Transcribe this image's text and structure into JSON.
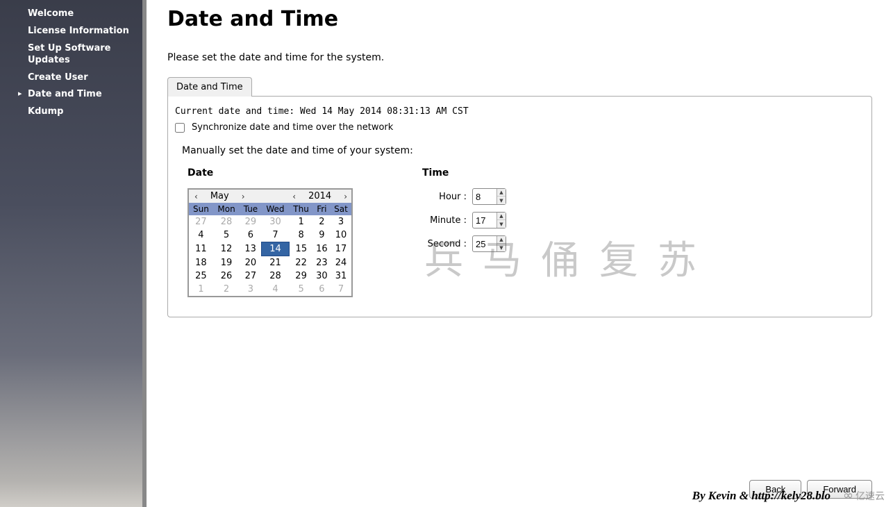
{
  "sidebar": {
    "items": [
      {
        "label": "Welcome"
      },
      {
        "label": "License Information"
      },
      {
        "label": "Set Up Software Updates"
      },
      {
        "label": "Create User"
      },
      {
        "label": "Date and Time"
      },
      {
        "label": "Kdump"
      }
    ]
  },
  "page": {
    "title": "Date and Time",
    "subtitle": "Please set the date and time for the system."
  },
  "tab": {
    "label": "Date and Time",
    "current_prefix": "Current date and time: ",
    "current_value": "Wed 14 May 2014 08:31:13 AM CST",
    "sync_label": "Synchronize date and time over the network",
    "manual_label": "Manually set the date and time of your system:"
  },
  "date": {
    "header": "Date",
    "month": "May",
    "year": "2014",
    "weekdays": [
      "Sun",
      "Mon",
      "Tue",
      "Wed",
      "Thu",
      "Fri",
      "Sat"
    ],
    "weeks": [
      [
        {
          "d": "27",
          "o": true
        },
        {
          "d": "28",
          "o": true
        },
        {
          "d": "29",
          "o": true
        },
        {
          "d": "30",
          "o": true
        },
        {
          "d": "1"
        },
        {
          "d": "2"
        },
        {
          "d": "3"
        }
      ],
      [
        {
          "d": "4"
        },
        {
          "d": "5"
        },
        {
          "d": "6"
        },
        {
          "d": "7"
        },
        {
          "d": "8"
        },
        {
          "d": "9"
        },
        {
          "d": "10"
        }
      ],
      [
        {
          "d": "11"
        },
        {
          "d": "12"
        },
        {
          "d": "13"
        },
        {
          "d": "14",
          "sel": true
        },
        {
          "d": "15"
        },
        {
          "d": "16"
        },
        {
          "d": "17"
        }
      ],
      [
        {
          "d": "18"
        },
        {
          "d": "19"
        },
        {
          "d": "20"
        },
        {
          "d": "21"
        },
        {
          "d": "22"
        },
        {
          "d": "23"
        },
        {
          "d": "24"
        }
      ],
      [
        {
          "d": "25"
        },
        {
          "d": "26"
        },
        {
          "d": "27"
        },
        {
          "d": "28"
        },
        {
          "d": "29"
        },
        {
          "d": "30"
        },
        {
          "d": "31"
        }
      ],
      [
        {
          "d": "1",
          "o": true
        },
        {
          "d": "2",
          "o": true
        },
        {
          "d": "3",
          "o": true
        },
        {
          "d": "4",
          "o": true
        },
        {
          "d": "5",
          "o": true
        },
        {
          "d": "6",
          "o": true
        },
        {
          "d": "7",
          "o": true
        }
      ]
    ]
  },
  "time": {
    "header": "Time",
    "hour_label": "Hour :",
    "minute_label": "Minute :",
    "second_label": "Second :",
    "hour": "8",
    "minute": "17",
    "second": "25"
  },
  "buttons": {
    "back": "Back",
    "forward": "Forward"
  },
  "watermark": "兵马俑复苏",
  "byline": "By Kevin & http://kely28.blo",
  "badge": "亿速云"
}
